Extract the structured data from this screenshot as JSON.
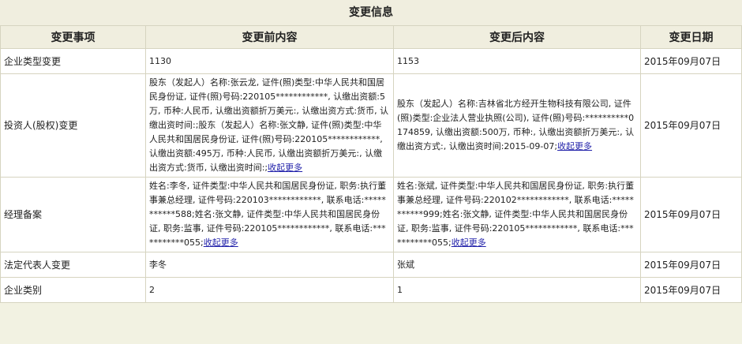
{
  "section_title": "变更信息",
  "headers": {
    "item": "变更事项",
    "before": "变更前内容",
    "after": "变更后内容",
    "date": "变更日期"
  },
  "toggle_label": "收起更多",
  "rows": [
    {
      "item": "企业类型变更",
      "before": "1130",
      "after": "1153",
      "date": "2015年09月07日"
    },
    {
      "item": "投资人(股权)变更",
      "before": "股东（发起人）名称:张云龙, 证件(照)类型:中华人民共和国居民身份证, 证件(照)号码:220105************, 认缴出资额:5万, 币种:人民币, 认缴出资额折万美元:, 认缴出资方式:货币, 认缴出资时间:;股东（发起人）名称:张文静, 证件(照)类型:中华人民共和国居民身份证, 证件(照)号码:220105************, 认缴出资额:495万, 币种:人民币, 认缴出资额折万美元:, 认缴出资方式:货币, 认缴出资时间:;",
      "after": "股东（发起人）名称:吉林省北方经开生物科技有限公司, 证件(照)类型:企业法人营业执照(公司), 证件(照)号码:**********0174859, 认缴出资额:500万, 币种:, 认缴出资额折万美元:, 认缴出资方式:, 认缴出资时间:2015-09-07;",
      "date": "2015年09月07日"
    },
    {
      "item": "经理备案",
      "before": "姓名:李冬, 证件类型:中华人民共和国居民身份证, 职务:执行董事兼总经理, 证件号码:220103************, 联系电话:***********588;姓名:张文静, 证件类型:中华人民共和国居民身份证, 职务:监事, 证件号码:220105************, 联系电话:***********055;",
      "after": "姓名:张斌, 证件类型:中华人民共和国居民身份证, 职务:执行董事兼总经理, 证件号码:220102************, 联系电话:***********999;姓名:张文静, 证件类型:中华人民共和国居民身份证, 职务:监事, 证件号码:220105************, 联系电话:***********055;",
      "date": "2015年09月07日"
    },
    {
      "item": "法定代表人变更",
      "before": "李冬",
      "after": "张斌",
      "date": "2015年09月07日"
    },
    {
      "item": "企业类别",
      "before": "2",
      "after": "1",
      "date": "2015年09月07日"
    }
  ]
}
